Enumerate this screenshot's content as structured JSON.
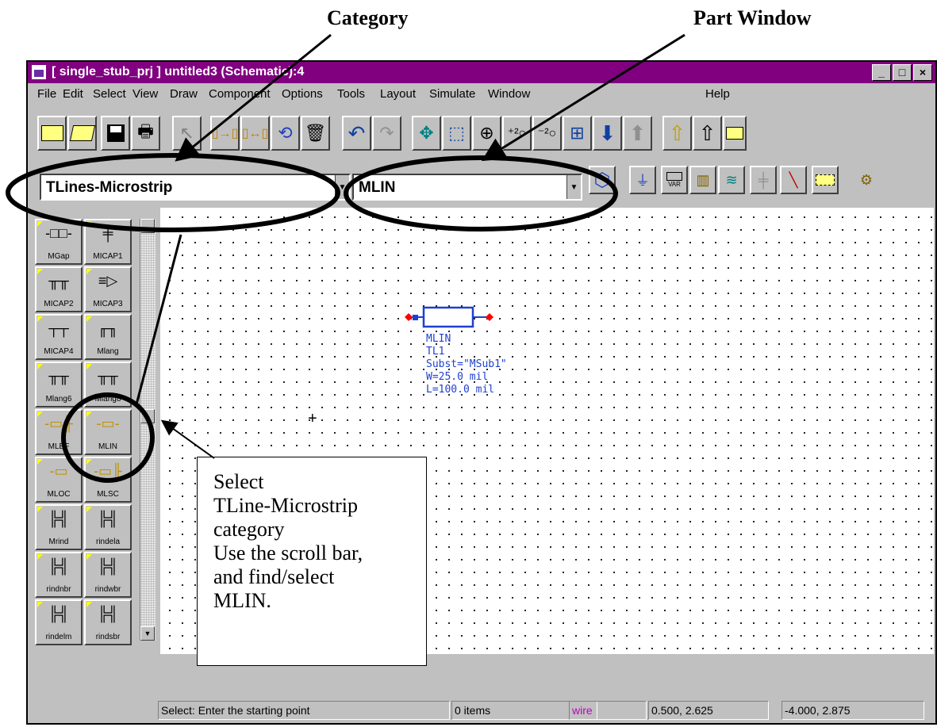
{
  "annotations": {
    "category_label": "Category",
    "part_window_label": "Part Window",
    "callout_text": "Select\nTLine-Microstrip\ncategory\nUse the scroll bar,\nand find/select\nMLIN."
  },
  "window": {
    "title": "[ single_stub_prj ] untitled3 (Schematic):4",
    "controls": [
      "_",
      "□",
      "×"
    ]
  },
  "menu": {
    "items": [
      "File",
      "Edit",
      "Select",
      "View",
      "Draw",
      "Component",
      "Options",
      "Tools",
      "Layout",
      "Simulate",
      "Window",
      "Help"
    ]
  },
  "toolbar": {
    "icons": [
      "new-folder-icon",
      "open-folder-icon",
      "save-icon",
      "print-icon",
      "select-arrow-icon",
      "insert-pin-icon",
      "insert-port-icon",
      "rotate-icon",
      "delete-icon",
      "undo-icon",
      "redo-icon",
      "pan-icon",
      "zoom-area-icon",
      "zoom-in-icon",
      "zoom-x2-icon",
      "zoom-out-icon",
      "zoom-fit-icon",
      "push-down-icon",
      "pop-up-icon",
      "up-arrow-icon",
      "up-arrow-outline-icon",
      "more-icon"
    ]
  },
  "selectors": {
    "category_value": "TLines-Microstrip",
    "part_value": "MLIN"
  },
  "toolbar2": {
    "icons": [
      "polygon-icon",
      "ground-icon",
      "var-icon",
      "library-icon",
      "simulation-icon",
      "port-icon",
      "wire-icon",
      "resistor-icon",
      "gear-icon"
    ],
    "var_label": "VAR"
  },
  "palette": {
    "items": [
      {
        "label": "MGap",
        "glyph": "-□□-"
      },
      {
        "label": "MICAP1",
        "glyph": "╪"
      },
      {
        "label": "MICAP2",
        "glyph": "╥╥"
      },
      {
        "label": "MICAP3",
        "glyph": "≡▷"
      },
      {
        "label": "MICAP4",
        "glyph": "┬┬"
      },
      {
        "label": "Mlang",
        "glyph": "╓╖"
      },
      {
        "label": "Mlang6",
        "glyph": "╥╥"
      },
      {
        "label": "Mlang8",
        "glyph": "╥╥"
      },
      {
        "label": "MLEF",
        "glyph": "-▭╟"
      },
      {
        "label": "MLIN",
        "glyph": "-▭-"
      },
      {
        "label": "MLOC",
        "glyph": "-▭"
      },
      {
        "label": "MLSC",
        "glyph": "-▭╟"
      },
      {
        "label": "Mrind",
        "glyph": "╠╣"
      },
      {
        "label": "rindela",
        "glyph": "╠╣"
      },
      {
        "label": "rindnbr",
        "glyph": "╠╣"
      },
      {
        "label": "rindwbr",
        "glyph": "╠╣"
      },
      {
        "label": "rindelm",
        "glyph": "╠╣"
      },
      {
        "label": "rindsbr",
        "glyph": "╠╣"
      }
    ]
  },
  "component": {
    "name": "MLIN",
    "instance": "TL1",
    "subst": "Subst=\"MSub1\"",
    "width": "W=25.0 mil",
    "length": "L=100.0 mil"
  },
  "status": {
    "message": "Select: Enter the starting point",
    "items": "0 items",
    "mode": "wire",
    "coord1": "0.500, 2.625",
    "coord2": "-4.000, 2.875"
  },
  "colors": {
    "titlebar": "#800080",
    "component": "#1f3fd0",
    "pin": "#ff0000",
    "status_mode": "#c000c0"
  }
}
